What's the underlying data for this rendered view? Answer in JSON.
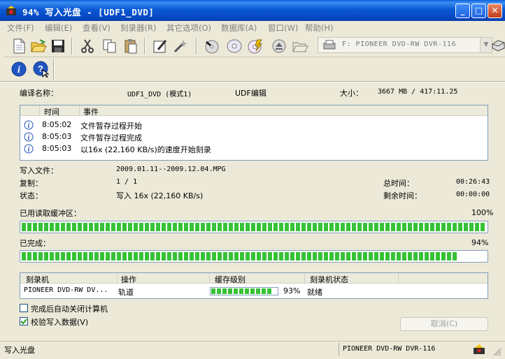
{
  "window": {
    "title": "94% 写入光盘 - [UDF1_DVD]",
    "minimize": "_",
    "maximize": "□",
    "close": "✕"
  },
  "menu": [
    {
      "label": "文件(F)"
    },
    {
      "label": "编辑(E)"
    },
    {
      "label": "查看(V)"
    },
    {
      "label": "刻录器(R)"
    },
    {
      "label": "其它选项(O)"
    },
    {
      "label": "数据库(A)"
    },
    {
      "label": "窗口(W)"
    },
    {
      "label": "帮助(H)"
    }
  ],
  "toolbar": {
    "drive_select": "F: PIONEER  DVD-RW  DVR-116",
    "icons": [
      "new-icon",
      "open-icon",
      "save-icon",
      "cut-icon",
      "copy-icon",
      "paste-icon",
      "properties-icon",
      "wizard-icon",
      "burn-icon",
      "disc-info-icon",
      "disc-quick-icon",
      "eject-icon",
      "open-folder-icon",
      "printer-icon"
    ]
  },
  "info": {
    "compile_label": "编译名称：",
    "compile_name": "UDF1_DVD (模式1)",
    "compile_type": "UDF编辑",
    "size_label": "大小：",
    "size_value": "3667 MB  / 417:11.25"
  },
  "log": {
    "columns": [
      "时间",
      "事件"
    ],
    "rows": [
      {
        "time": "8:05:02",
        "event": "文件暂存过程开始"
      },
      {
        "time": "8:05:03",
        "event": "文件暂存过程完成"
      },
      {
        "time": "8:05:03",
        "event": "以16x (22,160 KB/s)的速度开始刻录"
      }
    ]
  },
  "details": {
    "write_file_label": "写入文件：",
    "write_file_value": "2009.01.11--2009.12.04.MPG",
    "copy_label": "复制：",
    "copy_value": "1 / 1",
    "status_label": "状态：",
    "status_value": "写入 16x (22,160 KB/s)",
    "total_time_label": "总时间：",
    "total_time_value": "00:26:43",
    "remaining_label": "剩余时间：",
    "remaining_value": "00:00:00"
  },
  "buffer": {
    "label": "已用读取缓冲区：",
    "percent_text": "100%",
    "fraction": 1.0
  },
  "completed": {
    "label": "已完成：",
    "percent_text": "94%",
    "fraction": 0.94
  },
  "recorder_table": {
    "columns": [
      "刻录机",
      "操作",
      "缓存级别",
      "刻录机状态"
    ],
    "rows": [
      {
        "recorder": "PIONEER DVD-RW  DV...",
        "operation": "轨道",
        "cache_fraction": 0.93,
        "cache_text": "93%",
        "state": "就绪"
      }
    ]
  },
  "options": {
    "shutdown_label": "完成后自动关闭计算机",
    "shutdown_checked": false,
    "verify_label": "校验写入数据(V)",
    "verify_checked": true
  },
  "cancel_label": "取消(C)",
  "statusbar": {
    "left": "写入光盘",
    "right": "PIONEER  DVD-RW  DVR-116"
  },
  "colors": {
    "titlebar": "#0b58d4",
    "progress": "#36c236",
    "window_bg": "#ece9d8"
  }
}
